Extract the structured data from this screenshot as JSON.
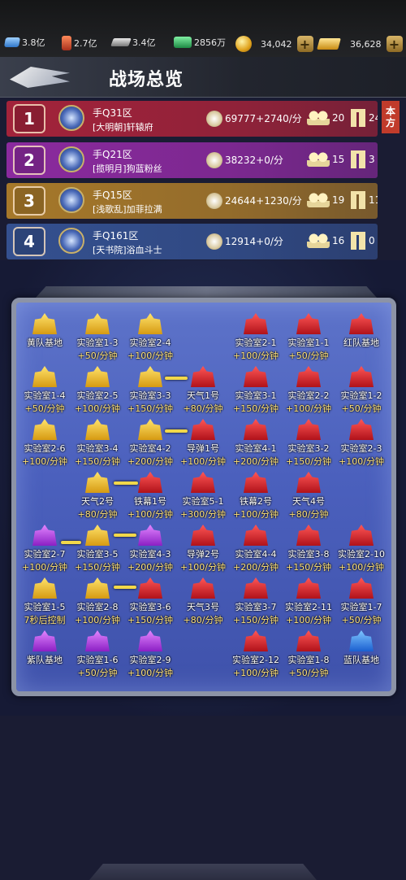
{
  "resources": [
    {
      "icon": "blue-crystal-icon",
      "value": "3.8亿"
    },
    {
      "icon": "red-barrel-icon",
      "value": "2.7亿"
    },
    {
      "icon": "steel-bar-icon",
      "value": "3.4亿"
    },
    {
      "icon": "green-cash-icon",
      "value": "2856万"
    },
    {
      "icon": "gold-coin-icon",
      "value": "34,042"
    },
    {
      "icon": "gold-bar-icon",
      "value": "36,628"
    }
  ],
  "header": {
    "title": "战场总览"
  },
  "my_side_label": [
    "本",
    "方"
  ],
  "teams": [
    {
      "rank": "1",
      "server": "手Q31区",
      "guild": "[大明朝]轩辕府",
      "score": "69777+2740/分",
      "players": "20",
      "buildings": "24",
      "color": "#a3233a"
    },
    {
      "rank": "2",
      "server": "手Q21区",
      "guild": "[揽明月]狗蓝粉丝",
      "score": "38232+0/分",
      "players": "15",
      "buildings": "3",
      "color": "#8b2a9e"
    },
    {
      "rank": "3",
      "server": "手Q15区",
      "guild": "[浅歌乱]加菲拉满",
      "score": "24644+1230/分",
      "players": "19",
      "buildings": "11",
      "color": "#a6782a"
    },
    {
      "rank": "4",
      "server": "手Q161区",
      "guild": "[天书院]浴血斗士",
      "score": "12914+0/分",
      "players": "16",
      "buildings": "0",
      "color": "#34508f"
    }
  ],
  "nodes": [
    {
      "name": "黄队基地",
      "rate": "",
      "color": "gold"
    },
    {
      "name": "实验室1-3",
      "rate": "+50/分钟",
      "color": "gold"
    },
    {
      "name": "实验室2-4",
      "rate": "+100/分钟",
      "color": "gold"
    },
    {
      "name": "实验室2-1",
      "rate": "+100/分钟",
      "color": "red"
    },
    {
      "name": "实验室1-1",
      "rate": "+50/分钟",
      "color": "red"
    },
    {
      "name": "红队基地",
      "rate": "",
      "color": "red"
    },
    {
      "name": "实验室1-4",
      "rate": "+50/分钟",
      "color": "gold"
    },
    {
      "name": "实验室2-5",
      "rate": "+100/分钟",
      "color": "gold"
    },
    {
      "name": "实验室3-3",
      "rate": "+150/分钟",
      "color": "gold"
    },
    {
      "name": "天气1号",
      "rate": "+80/分钟",
      "color": "red"
    },
    {
      "name": "实验室3-1",
      "rate": "+150/分钟",
      "color": "red"
    },
    {
      "name": "实验室2-2",
      "rate": "+100/分钟",
      "color": "red"
    },
    {
      "name": "实验室1-2",
      "rate": "+50/分钟",
      "color": "red"
    },
    {
      "name": "实验室2-6",
      "rate": "+100/分钟",
      "color": "gold"
    },
    {
      "name": "实验室3-4",
      "rate": "+150/分钟",
      "color": "gold"
    },
    {
      "name": "实验室4-2",
      "rate": "+200/分钟",
      "color": "gold"
    },
    {
      "name": "导弹1号",
      "rate": "+100/分钟",
      "color": "red"
    },
    {
      "name": "实验室4-1",
      "rate": "+200/分钟",
      "color": "red"
    },
    {
      "name": "实验室3-2",
      "rate": "+150/分钟",
      "color": "red"
    },
    {
      "name": "实验室2-3",
      "rate": "+100/分钟",
      "color": "red"
    },
    {
      "name": "天气2号",
      "rate": "+80/分钟",
      "color": "gold"
    },
    {
      "name": "铁幕1号",
      "rate": "+100/分钟",
      "color": "red"
    },
    {
      "name": "实验室5-1",
      "rate": "+300/分钟",
      "color": "red"
    },
    {
      "name": "铁幕2号",
      "rate": "+100/分钟",
      "color": "red"
    },
    {
      "name": "天气4号",
      "rate": "+80/分钟",
      "color": "red"
    },
    {
      "name": "实验室2-7",
      "rate": "+100/分钟",
      "color": "purple"
    },
    {
      "name": "实验室3-5",
      "rate": "+150/分钟",
      "color": "gold"
    },
    {
      "name": "实验室4-3",
      "rate": "+200/分钟",
      "color": "purple"
    },
    {
      "name": "导弹2号",
      "rate": "+100/分钟",
      "color": "red"
    },
    {
      "name": "实验室4-4",
      "rate": "+200/分钟",
      "color": "red"
    },
    {
      "name": "实验室3-8",
      "rate": "+150/分钟",
      "color": "red"
    },
    {
      "name": "实验室2-10",
      "rate": "+100/分钟",
      "color": "red"
    },
    {
      "name": "实验室1-5",
      "rate": "7秒后控制",
      "color": "gold"
    },
    {
      "name": "实验室2-8",
      "rate": "+100/分钟",
      "color": "gold"
    },
    {
      "name": "实验室3-6",
      "rate": "+150/分钟",
      "color": "red"
    },
    {
      "name": "天气3号",
      "rate": "+80/分钟",
      "color": "red"
    },
    {
      "name": "实验室3-7",
      "rate": "+150/分钟",
      "color": "red"
    },
    {
      "name": "实验室2-11",
      "rate": "+100/分钟",
      "color": "red"
    },
    {
      "name": "实验室1-7",
      "rate": "+50/分钟",
      "color": "red"
    },
    {
      "name": "紫队基地",
      "rate": "",
      "color": "purple"
    },
    {
      "name": "实验室1-6",
      "rate": "+50/分钟",
      "color": "purple"
    },
    {
      "name": "实验室2-9",
      "rate": "+100/分钟",
      "color": "purple"
    },
    {
      "name": "实验室2-12",
      "rate": "+100/分钟",
      "color": "red"
    },
    {
      "name": "实验室1-8",
      "rate": "+50/分钟",
      "color": "red"
    },
    {
      "name": "蓝队基地",
      "rate": "",
      "color": "blue"
    }
  ]
}
